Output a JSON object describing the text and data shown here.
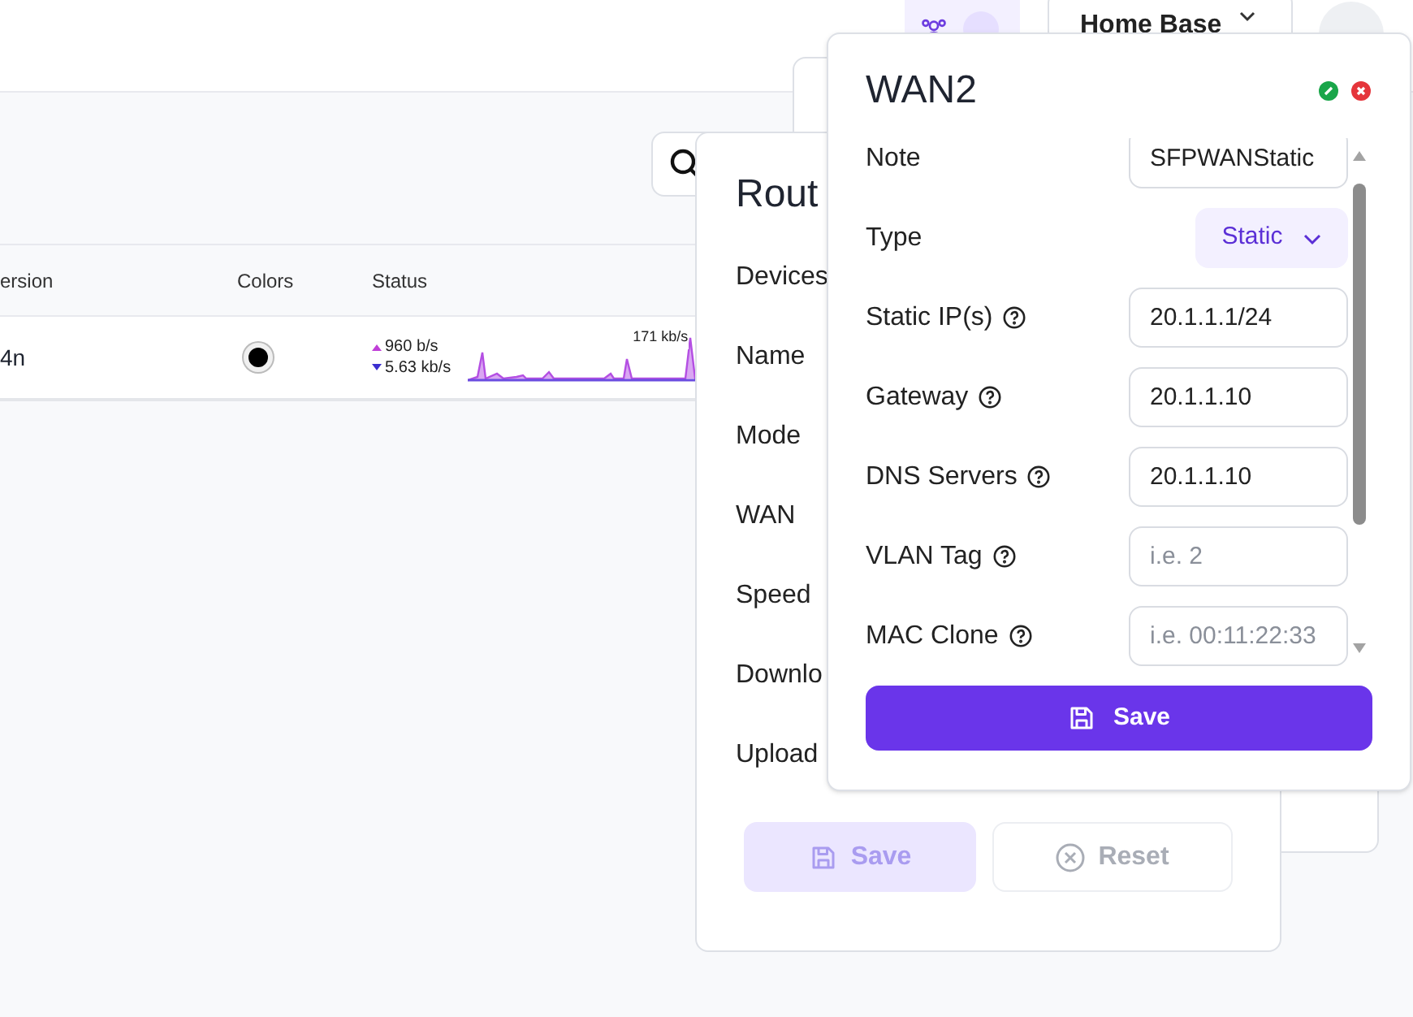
{
  "header": {
    "account_selector": "Home Base"
  },
  "table": {
    "columns": [
      "ersion",
      "Colors",
      "Status"
    ],
    "rows": [
      {
        "version": "4n",
        "color": "#000000",
        "upload": "960 b/s",
        "download": "5.63 kb/s",
        "peak": "171 kb/s"
      }
    ]
  },
  "router_panel": {
    "title": "Rout",
    "fields": [
      "Devices",
      "Name",
      "Mode",
      "WAN",
      "Speed",
      "Downlo",
      "Upload"
    ],
    "buttons": [
      {
        "kind": "save",
        "label": "Save",
        "disabled": true
      },
      {
        "kind": "reset",
        "label": "Reset",
        "disabled": true
      }
    ]
  },
  "wan_dialog": {
    "title": "WAN2",
    "fields": [
      {
        "kind": "input",
        "label": "Note",
        "value": "SFPWANStatic",
        "help": false
      },
      {
        "kind": "select",
        "label": "Type",
        "value": "Static",
        "help": false
      },
      {
        "kind": "input",
        "label": "Static IP(s)",
        "value": "20.1.1.1/24",
        "help": true
      },
      {
        "kind": "input",
        "label": "Gateway",
        "value": "20.1.1.10",
        "help": true
      },
      {
        "kind": "input",
        "label": "DNS Servers",
        "value": "20.1.1.10",
        "help": true
      },
      {
        "kind": "input",
        "label": "VLAN Tag",
        "placeholder": "i.e. 2",
        "help": true
      },
      {
        "kind": "input",
        "label": "MAC Clone",
        "placeholder": "i.e. 00:11:22:33",
        "help": true
      }
    ],
    "save": "Save"
  }
}
